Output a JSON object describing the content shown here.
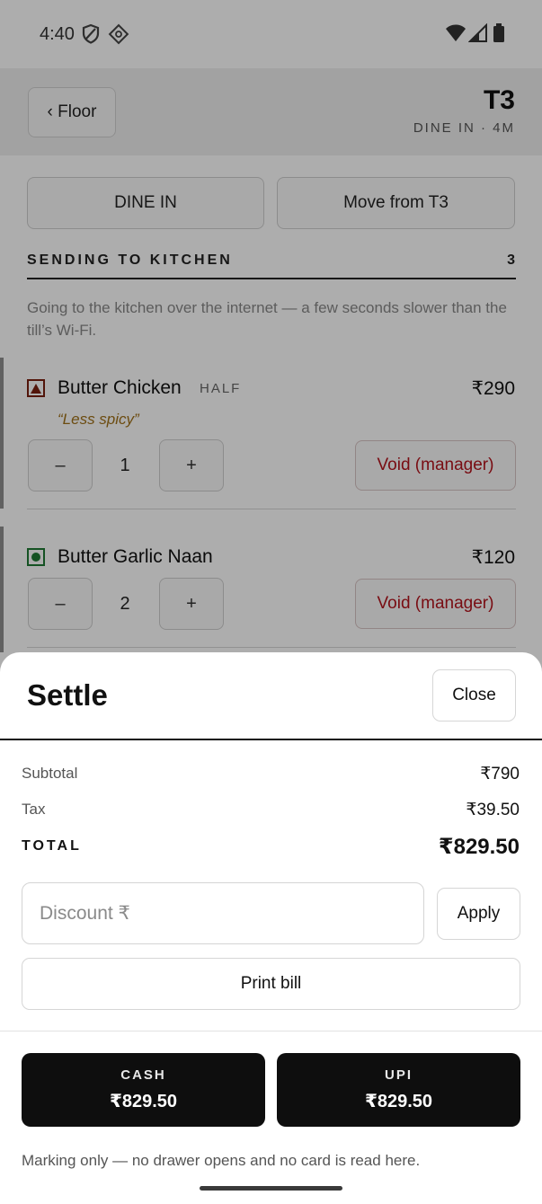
{
  "status_bar": {
    "time": "4:40",
    "icons": [
      "shield-icon",
      "diamond-icon",
      "wifi-icon",
      "signal-icon",
      "battery-icon"
    ]
  },
  "header": {
    "back_label": "‹ Floor",
    "table": "T3",
    "subtitle": "DINE IN · 4M"
  },
  "controls": {
    "order_type": "DINE IN",
    "move": "Move from T3"
  },
  "section": {
    "label": "SENDING TO KITCHEN",
    "count": "3",
    "note": "Going to the kitchen over the internet — a few seconds slower than the till’s Wi-Fi."
  },
  "items": [
    {
      "name": "Butter Chicken",
      "portion": "HALF",
      "price": "₹290",
      "note": "“Less spicy”",
      "diet": "non-veg",
      "qty": "1",
      "minus": "–",
      "plus": "+",
      "void": "Void (manager)"
    },
    {
      "name": "Butter Garlic Naan",
      "price": "₹120",
      "diet": "veg",
      "qty": "2",
      "minus": "–",
      "plus": "+",
      "void": "Void (manager)"
    }
  ],
  "settle": {
    "title": "Settle",
    "close": "Close",
    "subtotal_label": "Subtotal",
    "subtotal": "₹790",
    "tax_label": "Tax",
    "tax": "₹39.50",
    "total_label": "TOTAL",
    "total": "₹829.50",
    "discount_placeholder": "Discount ₹",
    "apply": "Apply",
    "print": "Print bill",
    "cash_label": "CASH",
    "cash_amount": "₹829.50",
    "upi_label": "UPI",
    "upi_amount": "₹829.50",
    "footer": "Marking only — no drawer opens and no card is read here."
  },
  "colors": {
    "void_red": "#b3141c",
    "note_amber": "#a07018",
    "veg_green": "#1f7a34",
    "nonveg_brown": "#7a2010",
    "pay_button": "#0e0e0e"
  }
}
